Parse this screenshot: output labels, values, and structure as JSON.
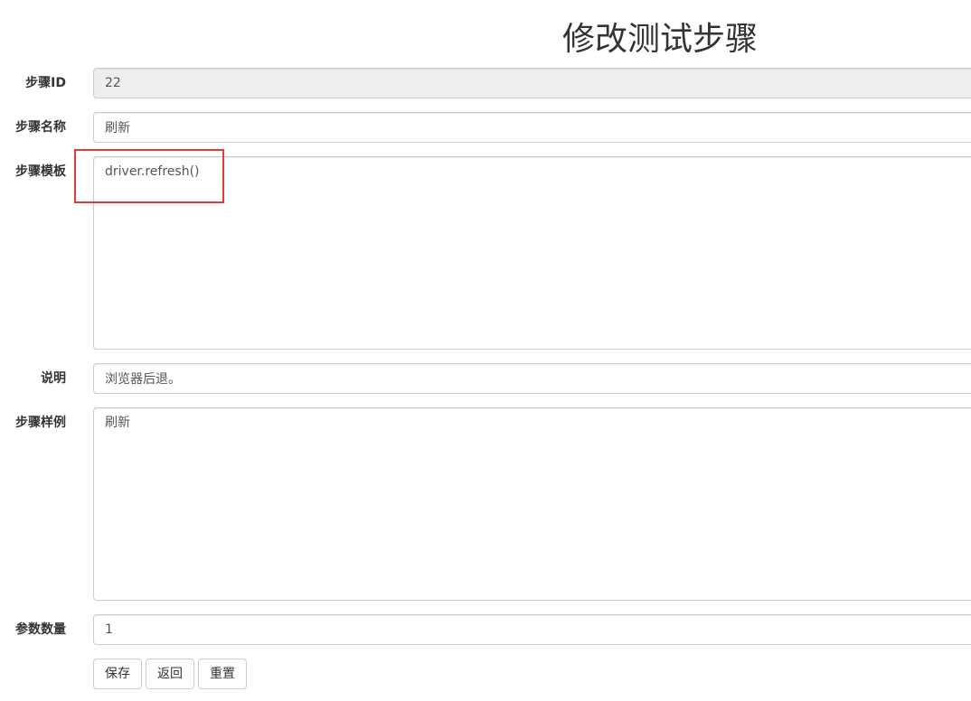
{
  "page": {
    "title": "修改测试步骤"
  },
  "form": {
    "step_id": {
      "label": "步骤ID",
      "value": "22"
    },
    "step_name": {
      "label": "步骤名称",
      "value": "刷新"
    },
    "step_template": {
      "label": "步骤模板",
      "value": "driver.refresh()"
    },
    "description": {
      "label": "说明",
      "value": "浏览器后退。"
    },
    "step_example": {
      "label": "步骤样例",
      "value": "刷新"
    },
    "param_count": {
      "label": "参数数量",
      "value": "1"
    }
  },
  "buttons": {
    "save": "保存",
    "back": "返回",
    "reset": "重置"
  },
  "annotation": {
    "highlight_color": "#e53935"
  }
}
